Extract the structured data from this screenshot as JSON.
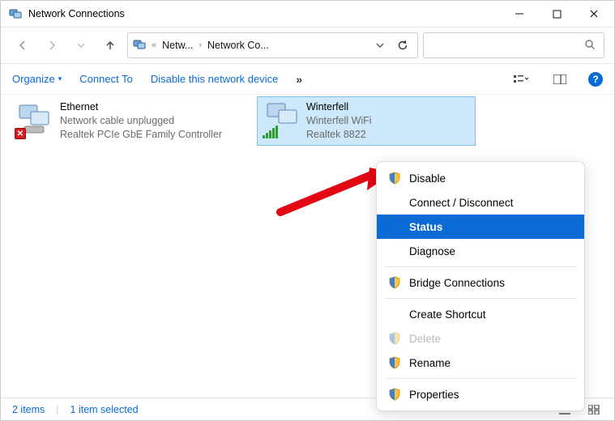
{
  "window": {
    "title": "Network Connections"
  },
  "breadcrumb": {
    "prefix": "«",
    "segments": [
      "Netw...",
      "Network Co..."
    ]
  },
  "toolbar": {
    "organize": "Organize",
    "connect_to": "Connect To",
    "disable_device": "Disable this network device",
    "overflow_glyph": "»"
  },
  "connections": {
    "ethernet": {
      "name": "Ethernet",
      "status": "Network cable unplugged",
      "adapter": "Realtek PCIe GbE Family Controller"
    },
    "wifi": {
      "name": "Winterfell",
      "status": "Winterfell WiFi",
      "adapter": "Realtek 8822"
    }
  },
  "context_menu": {
    "disable": "Disable",
    "connect_disconnect": "Connect / Disconnect",
    "status": "Status",
    "diagnose": "Diagnose",
    "bridge": "Bridge Connections",
    "create_shortcut": "Create Shortcut",
    "delete": "Delete",
    "rename": "Rename",
    "properties": "Properties"
  },
  "statusbar": {
    "items": "2 items",
    "selected": "1 item selected"
  }
}
